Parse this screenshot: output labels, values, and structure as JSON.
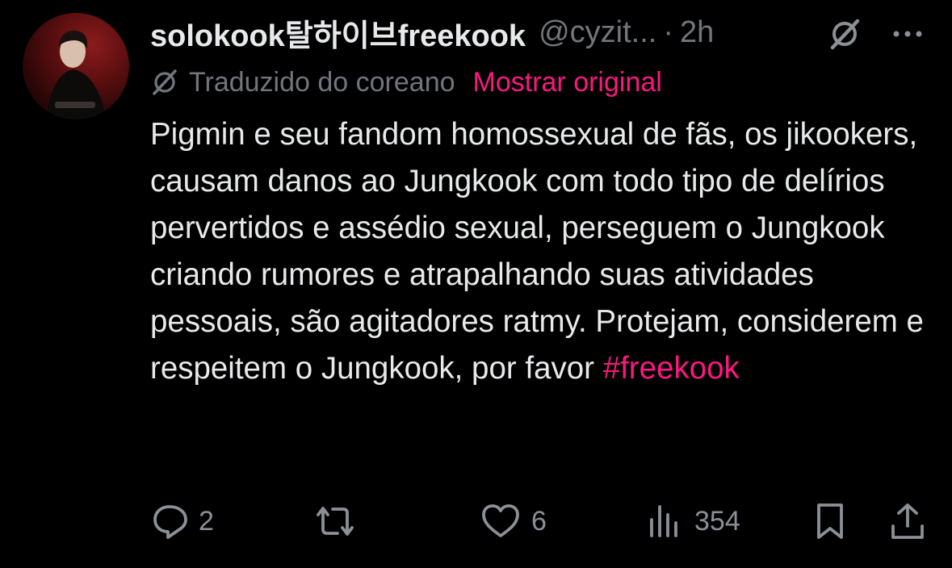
{
  "post": {
    "author_name": "solokook탈하이브freekook",
    "author_handle": "@cyzit...",
    "separator": "·",
    "time": "2h",
    "translation_label": "Traduzido do coreano",
    "show_original_label": "Mostrar original",
    "body_text": "Pigmin e seu fandom homossexual de fãs, os jikookers, causam danos ao Jungkook com todo tipo de delírios pervertidos e assédio sexual, perseguem o Jungkook criando rumores e atrapalhando suas atividades pessoais, são agitadores ratmy. Protejam, considerem e respeitem o Jungkook, por favor",
    "hashtag": "#freekook"
  },
  "actions": {
    "replies": "2",
    "retweets": "",
    "likes": "6",
    "views": "354"
  },
  "icons": [
    "avatar",
    "grok-icon",
    "more-icon",
    "translate-icon",
    "reply-icon",
    "retweet-icon",
    "like-icon",
    "views-icon",
    "bookmark-icon",
    "share-icon"
  ],
  "colors": {
    "background": "#000000",
    "text": "#e7e9ea",
    "muted": "#71767b",
    "accent": "#f91880"
  }
}
